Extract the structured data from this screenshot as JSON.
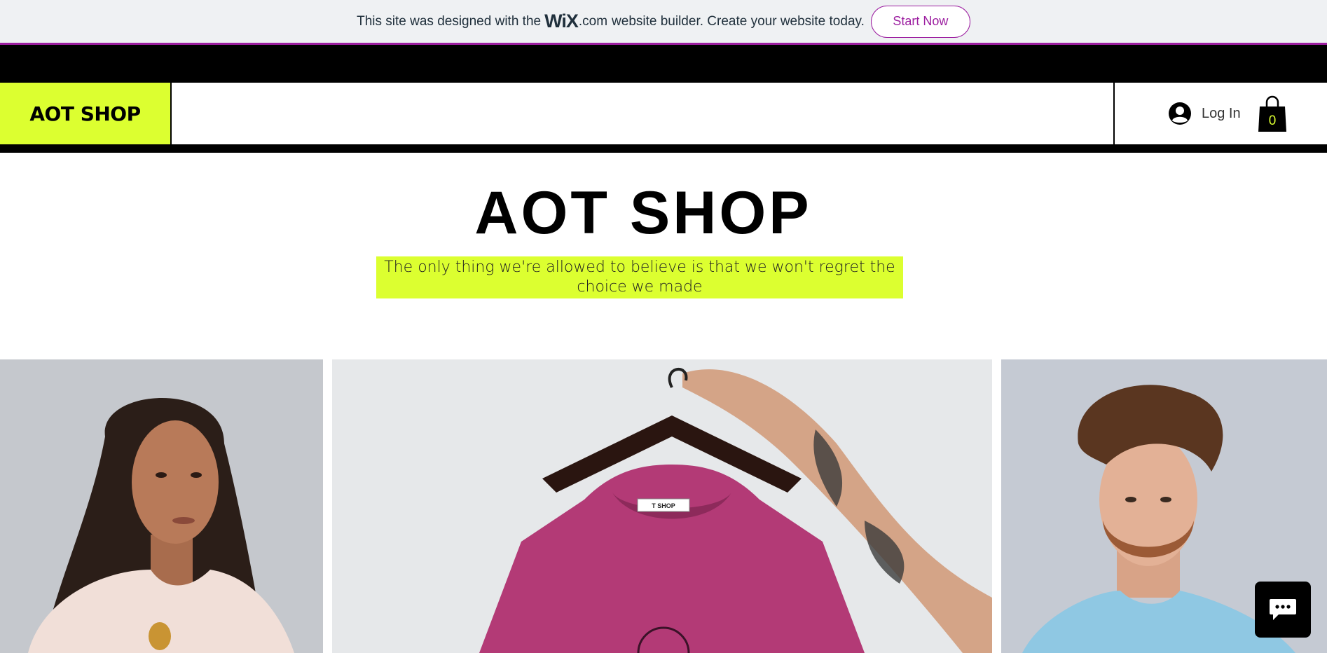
{
  "wix_banner": {
    "text_before": "This site was designed with the",
    "logo_text": "WiX",
    "domain_text": ".com",
    "text_after": "website builder. Create your website today.",
    "button_label": "Start Now",
    "accent_color": "#9c1ea0"
  },
  "header": {
    "brand": "AOT SHOP",
    "brand_bg_color": "#dcff30",
    "login_label": "Log In",
    "cart_count": "0",
    "icons": [
      "avatar-icon",
      "shopping-bag-icon"
    ]
  },
  "hero": {
    "title": "AOT SHOP",
    "tagline": "The only thing we're allowed to believe is that we won't regret the choice we made"
  },
  "gallery": {
    "items": [
      {
        "alt": "woman in light pink t-shirt",
        "name": "model-woman"
      },
      {
        "alt": "magenta t-shirt on hanger",
        "name": "tshirt-hanger"
      },
      {
        "alt": "man in light blue t-shirt",
        "name": "model-man"
      }
    ],
    "hanger_tag_text": "T SHOP"
  },
  "chat": {
    "icon": "chat-bubble-icon"
  }
}
